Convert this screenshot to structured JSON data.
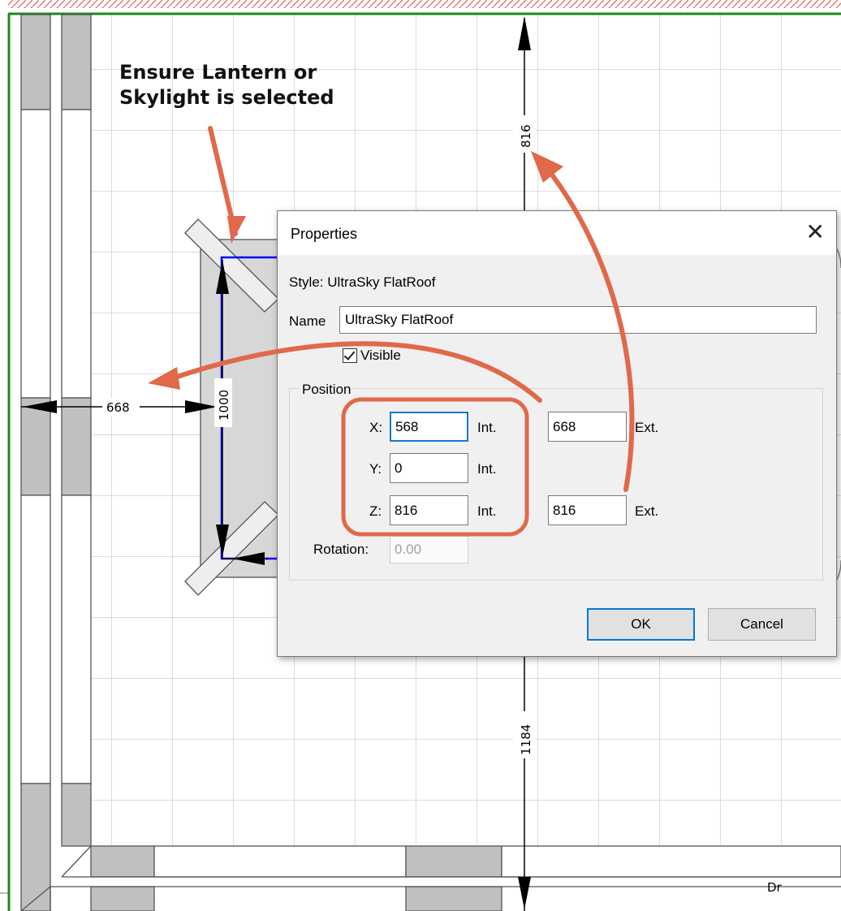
{
  "annotation": {
    "line1": "Ensure Lantern or",
    "line2": "Skylight is selected"
  },
  "dimensions": {
    "left": "668",
    "height": "1000",
    "top": "816",
    "bottom": "1184",
    "corner_text": "Dr"
  },
  "dialog": {
    "title": "Properties",
    "close_icon": "close-icon",
    "style_label": "Style:",
    "style_value": "UltraSky FlatRoof",
    "name_label": "Name",
    "name_value": "UltraSky FlatRoof",
    "visible_label": "Visible",
    "visible_checked": true,
    "position_group": "Position",
    "x_label": "X:",
    "x_int": "568",
    "x_ext": "668",
    "y_label": "Y:",
    "y_int": "0",
    "z_label": "Z:",
    "z_int": "816",
    "z_ext": "816",
    "int_label": "Int.",
    "ext_label": "Ext.",
    "rotation_label": "Rotation:",
    "rotation_value": "0.00",
    "ok_label": "OK",
    "cancel_label": "Cancel"
  },
  "colors": {
    "accent": "#0078d7",
    "annotation_arrow": "#e0694a",
    "wall_outline": "#1b8a1b",
    "selection": "#0000ff"
  }
}
